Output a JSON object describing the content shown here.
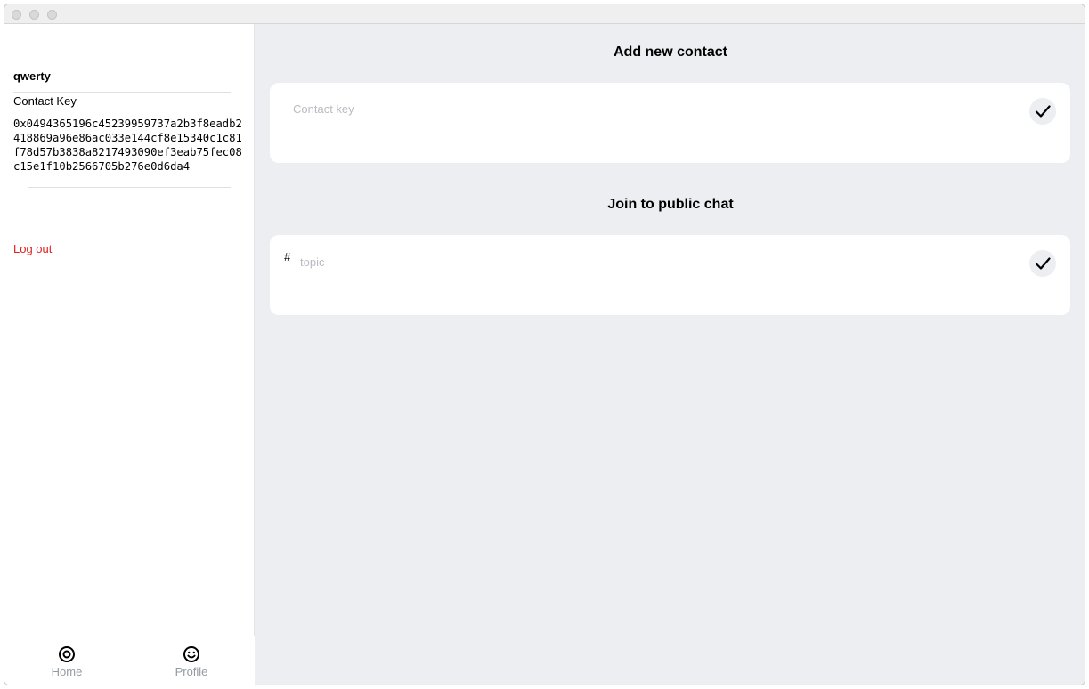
{
  "sidebar": {
    "username": "qwerty",
    "contact_key_label": "Contact Key",
    "contact_key_value": "0x0494365196c45239959737a2b3f8eadb2418869a96e86ac033e144cf8e15340c1c81f78d57b3838a8217493090ef3eab75fec08c15e1f10b2566705b276e0d6da4",
    "logout_label": "Log out",
    "logout_color": "#e0201f",
    "nav": [
      {
        "label": "Home",
        "icon": "home-icon"
      },
      {
        "label": "Profile",
        "icon": "profile-icon"
      }
    ]
  },
  "main": {
    "add_contact": {
      "title": "Add new contact",
      "placeholder": "Contact key",
      "submit_icon": "checkmark-icon"
    },
    "public_chat": {
      "title": "Join to public chat",
      "prefix": "#",
      "placeholder": "topic",
      "submit_icon": "checkmark-icon"
    }
  }
}
